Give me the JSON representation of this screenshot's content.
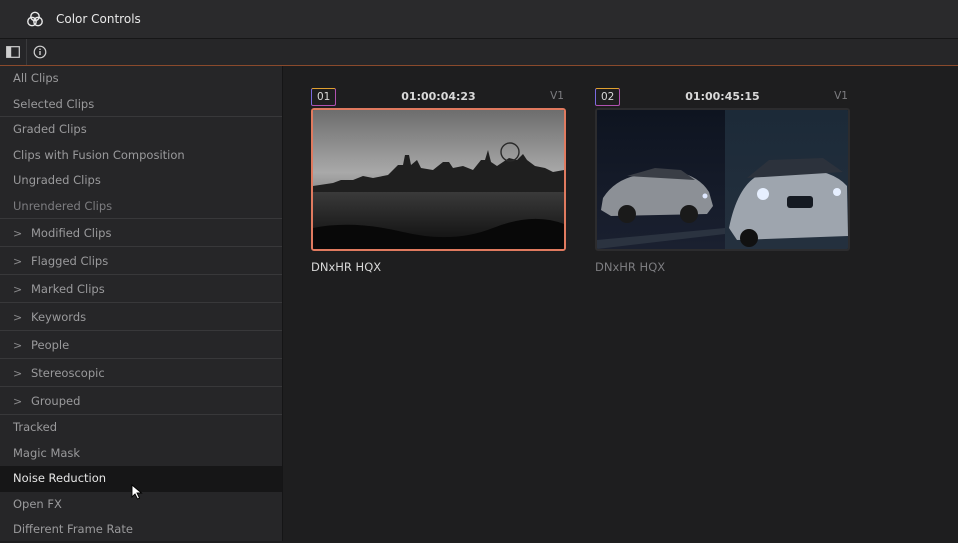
{
  "window": {
    "title": "Color Controls"
  },
  "toolbar": {
    "buttons": [
      "sidebar-toggle-icon",
      "info-icon"
    ]
  },
  "sidebar": {
    "items": [
      {
        "label": "All Clips",
        "kind": "plain",
        "sep": false
      },
      {
        "label": "Selected Clips",
        "kind": "plain",
        "sep": true
      },
      {
        "label": "Graded Clips",
        "kind": "plain",
        "sep": false
      },
      {
        "label": "Clips with Fusion Composition",
        "kind": "plain",
        "sep": false
      },
      {
        "label": "Ungraded Clips",
        "kind": "plain",
        "sep": false
      },
      {
        "label": "Unrendered Clips",
        "kind": "plain",
        "sep": true,
        "dim": true
      },
      {
        "label": "Modified Clips",
        "kind": "group"
      },
      {
        "label": "Flagged Clips",
        "kind": "group"
      },
      {
        "label": "Marked Clips",
        "kind": "group"
      },
      {
        "label": "Keywords",
        "kind": "group"
      },
      {
        "label": "People",
        "kind": "group"
      },
      {
        "label": "Stereoscopic",
        "kind": "group"
      },
      {
        "label": "Grouped",
        "kind": "group"
      },
      {
        "label": "Tracked",
        "kind": "plain",
        "sep": false
      },
      {
        "label": "Magic Mask",
        "kind": "plain",
        "sep": false
      },
      {
        "label": "Noise Reduction",
        "kind": "plain",
        "sep": false,
        "active": true
      },
      {
        "label": "Open FX",
        "kind": "plain",
        "sep": false
      },
      {
        "label": "Different Frame Rate",
        "kind": "plain",
        "sep": false
      }
    ]
  },
  "clips": [
    {
      "number": "01",
      "timecode": "01:00:04:23",
      "track": "V1",
      "codec": "DNxHR HQX",
      "selected": true
    },
    {
      "number": "02",
      "timecode": "01:00:45:15",
      "track": "V1",
      "codec": "DNxHR HQX",
      "selected": false
    }
  ],
  "colors": {
    "accent": "#e07a5f",
    "toolbar_rule": "#8a4a2c"
  }
}
